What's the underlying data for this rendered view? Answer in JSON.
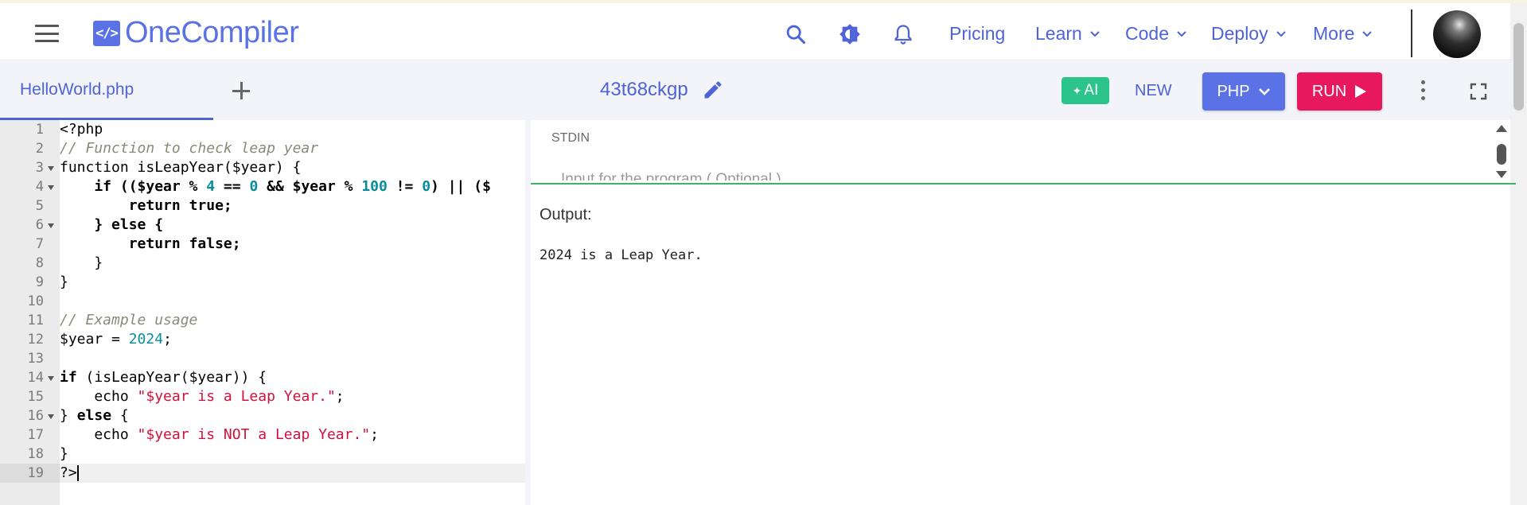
{
  "header": {
    "logo_symbol": "</>",
    "logo_text": "OneCompiler",
    "nav": [
      {
        "label": "Pricing"
      },
      {
        "label": "Learn"
      },
      {
        "label": "Code"
      },
      {
        "label": "Deploy"
      },
      {
        "label": "More"
      }
    ]
  },
  "toolbar": {
    "file_tab": "HelloWorld.php",
    "code_id": "43t68ckgp",
    "ai_label": "AI",
    "new_label": "NEW",
    "language": "PHP",
    "run_label": "RUN"
  },
  "editor": {
    "line_numbers": [
      "1",
      "2",
      "3",
      "4",
      "5",
      "6",
      "7",
      "8",
      "9",
      "10",
      "11",
      "12",
      "13",
      "14",
      "15",
      "16",
      "17",
      "18",
      "19"
    ],
    "lines": {
      "l1": "<?php",
      "l2": "// Function to check leap year",
      "l3": "function isLeapYear($year) {",
      "l4a": "    if (($year % ",
      "l4b": "4",
      "l4c": " == ",
      "l4d": "0",
      "l4e": " && $year % ",
      "l4f": "100",
      "l4g": " != ",
      "l4h": "0",
      "l4i": ") || ($",
      "l5a": "        ",
      "l5b": "return",
      "l5c": " true;",
      "l6a": "    } ",
      "l6b": "else",
      "l6c": " {",
      "l7a": "        ",
      "l7b": "return",
      "l7c": " false;",
      "l8": "    }",
      "l9": "}",
      "l10": "",
      "l11": "// Example usage",
      "l12a": "$year = ",
      "l12b": "2024",
      "l12c": ";",
      "l13": "",
      "l14a": "if",
      "l14b": " (isLeapYear($year)) {",
      "l15a": "    echo ",
      "l15b": "\"$year is a Leap Year.\"",
      "l15c": ";",
      "l16a": "} ",
      "l16b": "else",
      "l16c": " {",
      "l17a": "    echo ",
      "l17b": "\"$year is NOT a Leap Year.\"",
      "l17c": ";",
      "l18": "}",
      "l19": "?>"
    }
  },
  "stdin": {
    "label": "STDIN",
    "placeholder": "Input for the program ( Optional )"
  },
  "output": {
    "label": "Output:",
    "text": "2024 is a Leap Year."
  },
  "colors": {
    "brand": "#5a72e6",
    "run": "#e8185f",
    "ai": "#2bc48a",
    "divider_green": "#3cb56a"
  }
}
